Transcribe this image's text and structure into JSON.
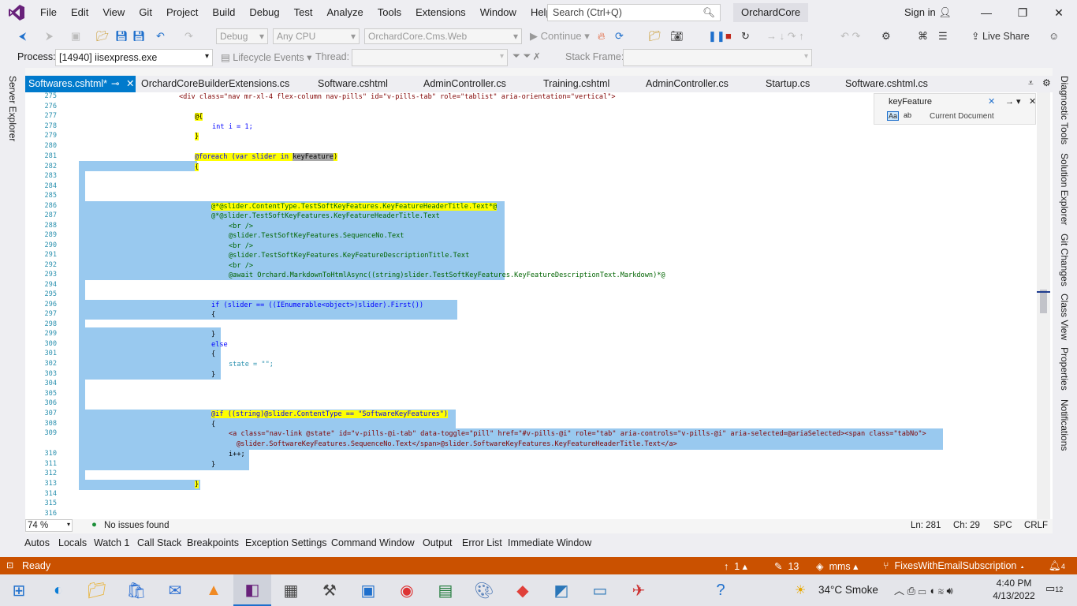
{
  "menu": [
    "File",
    "Edit",
    "View",
    "Git",
    "Project",
    "Build",
    "Debug",
    "Test",
    "Analyze",
    "Tools",
    "Extensions",
    "Window",
    "Help"
  ],
  "search_placeholder": "Search (Ctrl+Q)",
  "solution_name": "OrchardCore",
  "sign_in": "Sign in",
  "toolbar": {
    "config": "Debug",
    "platform": "Any CPU",
    "startup": "OrchardCore.Cms.Web",
    "continue": "Continue",
    "live_share": "Live Share"
  },
  "procbar": {
    "process_label": "Process:",
    "process_value": "[14940] iisexpress.exe",
    "lifecycle": "Lifecycle Events",
    "thread": "Thread:",
    "stack_frame": "Stack Frame:"
  },
  "left_side_tab": "Server Explorer",
  "right_side_tabs": [
    "Diagnostic Tools",
    "Solution Explorer",
    "Git Changes",
    "Class View",
    "Properties",
    "Notifications"
  ],
  "doc_tabs": [
    "Softwares.cshtml*",
    "OrchardCoreBuilderExtensions.cs",
    "Software.cshtml",
    "AdminController.cs",
    "Training.cshtml",
    "AdminController.cs",
    "Startup.cs",
    "Software.cshtml.cs"
  ],
  "find": {
    "query": "keyFeature",
    "scope": "Current Document",
    "case_label": "Aa",
    "word_label": "ab"
  },
  "line_numbers": [
    "275",
    "276",
    "277",
    "278",
    "279",
    "280",
    "281",
    "282",
    "283",
    "284",
    "285",
    "286",
    "287",
    "288",
    "289",
    "290",
    "291",
    "292",
    "293",
    "294",
    "295",
    "296",
    "297",
    "298",
    "299",
    "300",
    "301",
    "302",
    "303",
    "304",
    "305",
    "306",
    "307",
    "308",
    "309",
    "",
    "310",
    "311",
    "312",
    "313",
    "314",
    "315",
    "316"
  ],
  "code": {
    "l275": "<div class=\"nav mr-xl-4 flex-column nav-pills\" id=\"v-pills-tab\" role=\"tablist\" aria-orientation=\"vertical\">",
    "l277": "@{",
    "l278": "int i = 1;",
    "l279": "}",
    "l281a": "@foreach (var slider in ",
    "l281b": "keyFeature",
    "l281c": ")",
    "l282": "{",
    "l286": "@*@slider.ContentType.TestSoftKeyFeatures.KeyFeatureHeaderTitle.Text*@",
    "l287": "@*@slider.TestSoftKeyFeatures.KeyFeatureHeaderTitle.Text",
    "l288": "<br />",
    "l289": "@slider.TestSoftKeyFeatures.SequenceNo.Text",
    "l290": "<br />",
    "l291": "@slider.TestSoftKeyFeatures.KeyFeatureDescriptionTitle.Text",
    "l292": "<br />",
    "l293": "@await Orchard.MarkdownToHtmlAsync((string)slider.TestSoftKeyFeatures.KeyFeatureDescriptionText.Markdown)*@",
    "l296": "if (slider == ((IEnumerable<object>)slider).First())",
    "l297": "{",
    "l299": "}",
    "l300": "else",
    "l301": "{",
    "l302": "state = \"\";",
    "l303": "}",
    "l307": "@if ((string)@slider.ContentType == \"SoftwareKeyFeatures\")",
    "l308": "{",
    "l309": "<a class=\"nav-link @state\" id=\"v-pills-@i-tab\" data-toggle=\"pill\" href=\"#v-pills-@i\" role=\"tab\" aria-controls=\"v-pills-@i\" aria-selected=@ariaSelected><span class=\"tabNo\">",
    "l309b": "@slider.SoftwareKeyFeatures.SequenceNo.Text</span>@slider.SoftwareKeyFeatures.KeyFeatureHeaderTitle.Text</a>",
    "l310": "i++;",
    "l311": "}",
    "l313": "}"
  },
  "statusline": {
    "zoom": "74 %",
    "issues": "No issues found",
    "ln": "Ln: 281",
    "ch": "Ch: 29",
    "spc": "SPC",
    "crlf": "CRLF"
  },
  "bottom_tabs": [
    "Autos",
    "Locals",
    "Watch 1",
    "Call Stack",
    "Breakpoints",
    "Exception Settings",
    "Command Window",
    "Output",
    "Error List",
    "Immediate Window"
  ],
  "status": {
    "ready": "Ready",
    "up": "1",
    "edits": "13",
    "user": "mms",
    "branch": "FixesWithEmailSubscription",
    "notif": "4"
  },
  "taskbar": {
    "weather": "34°C  Smoke",
    "time": "4:40 PM",
    "date": "4/13/2022",
    "badge": "12"
  },
  "colors": {
    "accent": "#007acc",
    "status_bar": "#ca5100",
    "vs_purple": "#68217a",
    "selection": "#99c9ef"
  }
}
